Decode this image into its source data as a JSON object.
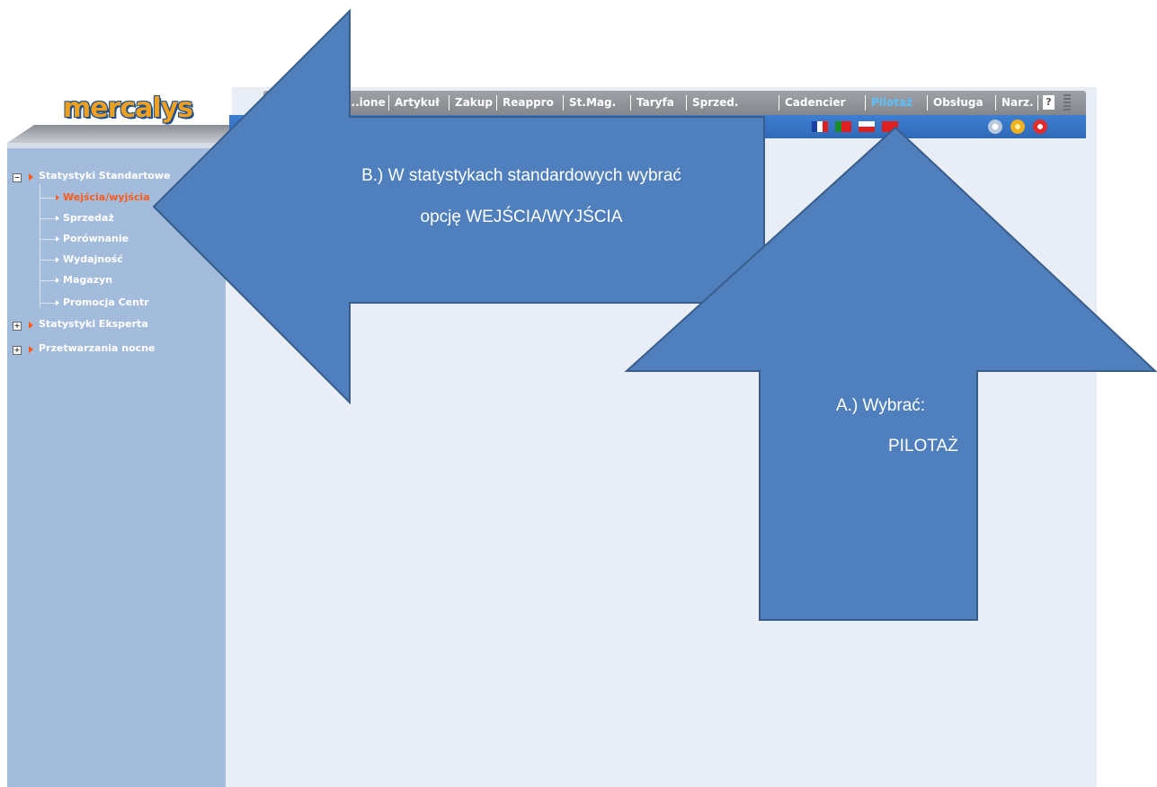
{
  "app": {
    "logo": "mercalys",
    "menu": [
      "...ione",
      "Artykuł",
      "Zakup",
      "Reappro",
      "St.Mag.",
      "Taryfa",
      "Sprzed.",
      "Cadencier",
      "Pilotaż",
      "Obsługa",
      "Narz."
    ],
    "help_label": "?",
    "active_menu": "Pilotaż"
  },
  "sidebar": {
    "groups": [
      {
        "label": "Statystyki Standartowe",
        "expanded": true,
        "toggle": "−",
        "items": [
          "Wejścia/wyjścia",
          "Sprzedaż",
          "Porównanie",
          "Wydajność",
          "Magazyn",
          "Promocja Centr"
        ],
        "active_item": "Wejścia/wyjścia"
      },
      {
        "label": "Statystyki Eksperta",
        "expanded": false,
        "toggle": "+"
      },
      {
        "label": "Przetwarzania nocne",
        "expanded": false,
        "toggle": "+"
      }
    ]
  },
  "toolbar": {
    "flags": [
      "fr-flag",
      "pt-flag",
      "pl-flag",
      "extra-flag"
    ],
    "icons": [
      "refresh-icon",
      "user-icon",
      "power-icon"
    ]
  },
  "callouts": {
    "b_text_line1": "B.) W statystykach standardowych wybrać",
    "b_text_line2": "opcję WEJŚCIA/WYJŚCIA",
    "a_text_line1": "A.)  Wybrać:",
    "a_text_line2": "PILOTAŻ"
  },
  "colors": {
    "arrow_fill": "#4f7fbc",
    "arrow_stroke": "#385d8a",
    "toolbar_blue": "#3471c2",
    "sidebar_blue": "#a4bcdc",
    "active_orange": "#ff5a1a"
  }
}
